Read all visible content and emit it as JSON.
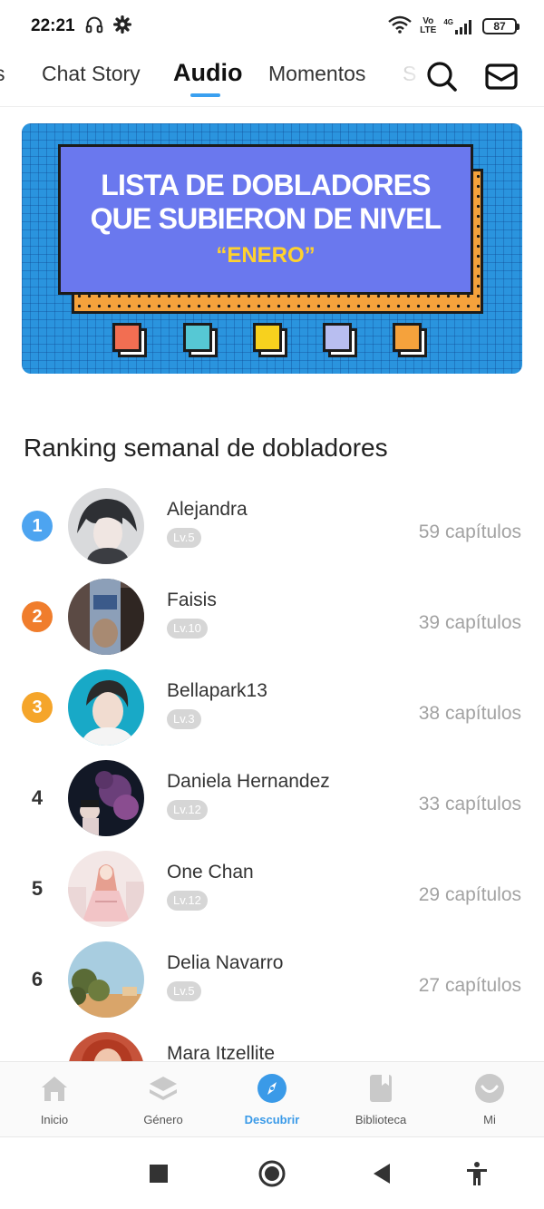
{
  "status_bar": {
    "time": "22:21",
    "network_top": "Vo",
    "network_bottom": "LTE",
    "signal_label": "4G",
    "battery": "87"
  },
  "tabs": [
    {
      "label": "s"
    },
    {
      "label": "Chat Story"
    },
    {
      "label": "Audio",
      "active": true
    },
    {
      "label": "Momentos"
    },
    {
      "label": "S"
    }
  ],
  "banner": {
    "line1": "LISTA DE DOBLADORES",
    "line2": "QUE SUBIERON DE NIVEL",
    "subtitle": "“ENERO”",
    "square_colors": [
      "#f26e52",
      "#56c8d4",
      "#f7d11e",
      "#b8bef0",
      "#f5a23c"
    ]
  },
  "ranking": {
    "title": "Ranking semanal de dobladores",
    "items": [
      {
        "rank": "1",
        "name": "Alejandra",
        "level": "Lv.5",
        "chapters": "59 capítulos",
        "medal_color": "#4da4f0"
      },
      {
        "rank": "2",
        "name": "Faisis",
        "level": "Lv.10",
        "chapters": "39 capítulos",
        "medal_color": "#f07d2c"
      },
      {
        "rank": "3",
        "name": "Bellapark13",
        "level": "Lv.3",
        "chapters": "38 capítulos",
        "medal_color": "#f5a52a"
      },
      {
        "rank": "4",
        "name": "Daniela Hernandez",
        "level": "Lv.12",
        "chapters": "33 capítulos"
      },
      {
        "rank": "5",
        "name": "One Chan",
        "level": "Lv.12",
        "chapters": "29 capítulos"
      },
      {
        "rank": "6",
        "name": "Delia Navarro",
        "level": "Lv.5",
        "chapters": "27 capítulos"
      },
      {
        "rank": "",
        "name": "Mara Itzellite",
        "level": "",
        "chapters": ""
      }
    ]
  },
  "bottom_nav": [
    {
      "label": "Inicio",
      "icon": "home-icon"
    },
    {
      "label": "Género",
      "icon": "layers-icon"
    },
    {
      "label": "Descubrir",
      "icon": "compass-icon",
      "active": true
    },
    {
      "label": "Biblioteca",
      "icon": "book-icon"
    },
    {
      "label": "Mi",
      "icon": "profile-icon"
    }
  ],
  "colors": {
    "accent": "#3a9ae8",
    "banner_blue": "#2a94de",
    "banner_panel": "#6a78ee",
    "banner_orange": "#f5a23c",
    "banner_yellow": "#ffd22e"
  }
}
